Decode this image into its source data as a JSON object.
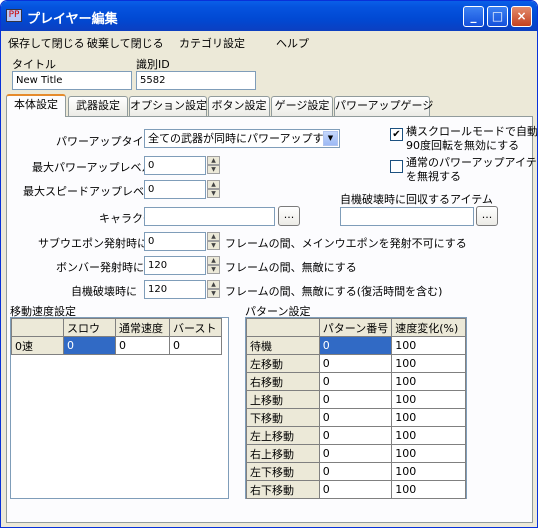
{
  "window": {
    "title": "プレイヤー編集",
    "icon_text": "PP"
  },
  "titlebar_buttons": {
    "minimize": "_",
    "maximize": "□",
    "close": "×"
  },
  "menu": [
    "保存して閉じる",
    "破棄して閉じる",
    "カテゴリ設定",
    "ヘルプ"
  ],
  "fields": {
    "title_label": "タイトル",
    "title_value": "New Title",
    "id_label": "識別ID",
    "id_value": "5582"
  },
  "tabs": [
    "本体設定",
    "武器設定",
    "オプション設定",
    "ボタン設定",
    "ゲージ設定",
    "パワーアップゲージ"
  ],
  "body": {
    "powerup_type_label": "パワーアップタイプ",
    "powerup_type_value": "全ての武器が同時にパワーアップする",
    "max_power_label": "最大パワーアップレベル",
    "max_power_value": "0",
    "max_speed_label": "最大スピードアップレベル",
    "max_speed_value": "0",
    "character_label": "キャラクタ",
    "character_value": "",
    "browse": "...",
    "self_destruct_item_label": "自機破壊時に回収するアイテム",
    "self_destruct_item_value": "",
    "sub_weapon_label": "サブウエポン発射時に",
    "sub_weapon_value": "0",
    "sub_weapon_suffix": "フレームの間、メインウエポンを発射不可にする",
    "bomber_label": "ボンバー発射時に",
    "bomber_value": "120",
    "bomber_suffix": "フレームの間、無敵にする",
    "destroy_label": "自機破壊時に",
    "destroy_value": "120",
    "destroy_suffix": "フレームの間、無敵にする(復活時間を含む)",
    "cb1_line1": "横スクロールモードで自動",
    "cb1_line2": "90度回転を無効にする",
    "cb1_checked": "✔",
    "cb2_line1": "通常のパワーアップアイテム",
    "cb2_line2": "を無視する"
  },
  "speed": {
    "section_label": "移動速度設定",
    "headers": [
      "",
      "スロウ",
      "通常速度",
      "バースト"
    ],
    "rows": [
      [
        "0速",
        "0",
        "0",
        "0"
      ]
    ]
  },
  "pattern": {
    "section_label": "パターン設定",
    "headers": [
      "",
      "パターン番号",
      "速度変化(%)"
    ],
    "rows": [
      [
        "待機",
        "0",
        "100"
      ],
      [
        "左移動",
        "0",
        "100"
      ],
      [
        "右移動",
        "0",
        "100"
      ],
      [
        "上移動",
        "0",
        "100"
      ],
      [
        "下移動",
        "0",
        "100"
      ],
      [
        "左上移動",
        "0",
        "100"
      ],
      [
        "右上移動",
        "0",
        "100"
      ],
      [
        "左下移動",
        "0",
        "100"
      ],
      [
        "右下移動",
        "0",
        "100"
      ]
    ]
  }
}
